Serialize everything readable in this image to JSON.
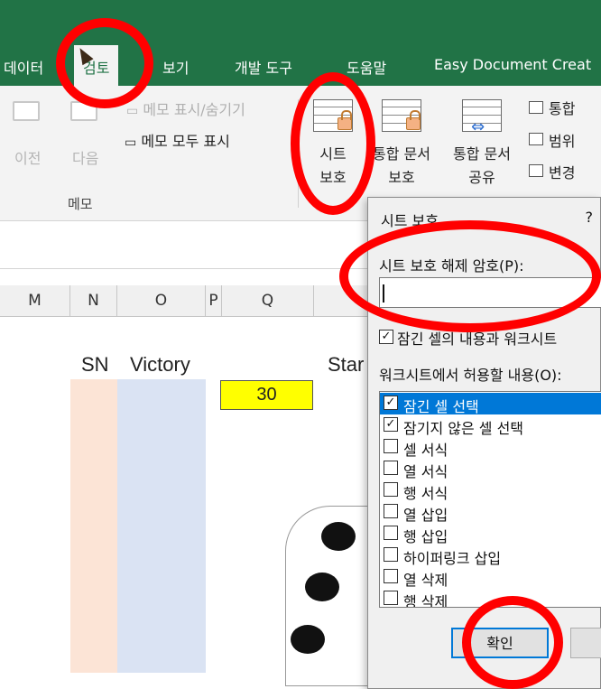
{
  "ribbon_tabs": {
    "data": "데이터",
    "review": "검토",
    "view": "보기",
    "developer": "개발 도구",
    "help": "도움말",
    "easydoc": "Easy Document Creat"
  },
  "ribbon": {
    "prev": "이전",
    "next": "다음",
    "show_hide_memo": "메모 표시/숨기기",
    "show_all_memo": "메모 모두 표시",
    "memo_group": "메모",
    "protect_sheet": [
      "시트",
      "보호"
    ],
    "protect_workbook": [
      "통합 문서",
      "보호"
    ],
    "share_workbook": [
      "통합 문서",
      "공유"
    ],
    "side_1": "통합",
    "side_2": "범위",
    "side_3": "변경"
  },
  "columns": [
    "M",
    "N",
    "O",
    "P",
    "Q"
  ],
  "sheet": {
    "sn": "SN",
    "victory": "Victory",
    "star": "Star",
    "value": "30"
  },
  "dialog": {
    "title": "시트 보호",
    "help": "?",
    "password_label": "시트 보호 해제 암호(P):",
    "password_value": "",
    "protect_contents": "잠긴 셀의 내용과 워크시트",
    "allow_label": "워크시트에서 허용할 내용(O):",
    "options": [
      {
        "label": "잠긴 셀 선택",
        "checked": true
      },
      {
        "label": "잠기지 않은 셀 선택",
        "checked": true
      },
      {
        "label": "셀 서식",
        "checked": false
      },
      {
        "label": "열 서식",
        "checked": false
      },
      {
        "label": "행 서식",
        "checked": false
      },
      {
        "label": "열 삽입",
        "checked": false
      },
      {
        "label": "행 삽입",
        "checked": false
      },
      {
        "label": "하이퍼링크 삽입",
        "checked": false
      },
      {
        "label": "열 삭제",
        "checked": false
      },
      {
        "label": "행 삭제",
        "checked": false
      }
    ],
    "ok": "확인"
  },
  "colors": {
    "ribbon_green": "#217346",
    "annotation_red": "#ff0000",
    "selection_blue": "#0078d7"
  }
}
